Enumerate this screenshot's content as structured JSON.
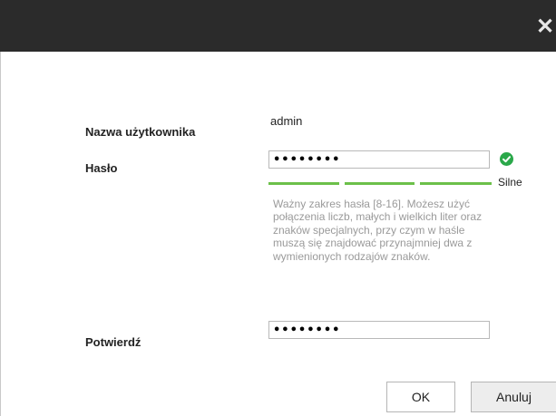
{
  "dialog": {
    "close_icon": "close-icon",
    "close_glyph": "✕"
  },
  "form": {
    "username": {
      "label": "Nazwa użytkownika",
      "value": "admin"
    },
    "password": {
      "label": "Hasło",
      "masked_value": "••••••••",
      "valid_icon": "check-circle-icon",
      "valid_color": "#2aa84a",
      "strength": {
        "segments_filled": 3,
        "segments_total": 3,
        "label": "Silne",
        "color": "#6cc04a"
      },
      "hint": "Ważny zakres hasła [8-16]. Możesz użyć połączenia liczb, małych i wielkich liter oraz znaków specjalnych, przy czym w haśle muszą się znajdować przynajmniej dwa z wymienionych rodzajów znaków."
    },
    "confirm": {
      "label": "Potwierdź",
      "masked_value": "••••••••"
    }
  },
  "buttons": {
    "ok_label": "OK",
    "cancel_label": "Anuluj"
  }
}
